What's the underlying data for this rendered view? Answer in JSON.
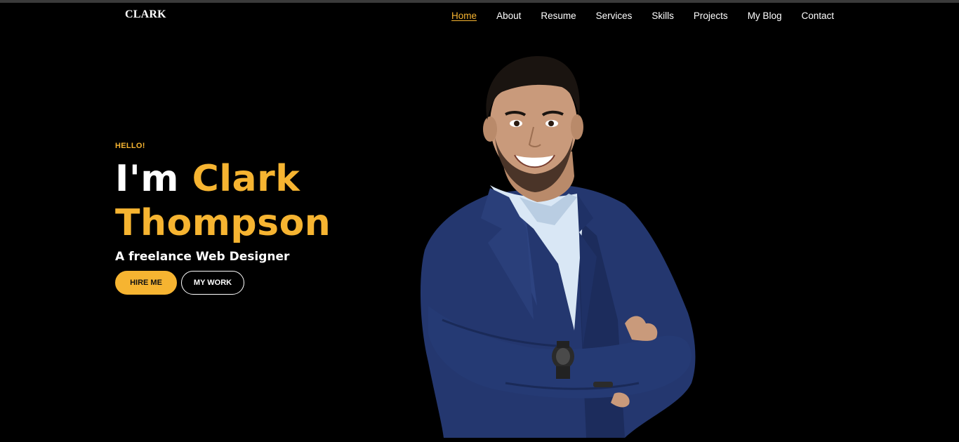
{
  "brand": {
    "logo": "CLARK"
  },
  "nav": {
    "items": [
      {
        "label": "Home",
        "active": true
      },
      {
        "label": "About"
      },
      {
        "label": "Resume"
      },
      {
        "label": "Services"
      },
      {
        "label": "Skills"
      },
      {
        "label": "Projects"
      },
      {
        "label": "My Blog"
      },
      {
        "label": "Contact"
      }
    ]
  },
  "hero": {
    "greeting": "HELLO!",
    "intro": "I'm",
    "first_name": "Clark",
    "last_name": "Thompson",
    "subtitle": "A freelance Web Designer",
    "hire_label": "HIRE ME",
    "work_label": "MY WORK"
  },
  "colors": {
    "accent": "#f6b431",
    "background": "#000000",
    "text": "#ffffff",
    "suit": "#24376f",
    "shirt": "#d9e7f5"
  }
}
